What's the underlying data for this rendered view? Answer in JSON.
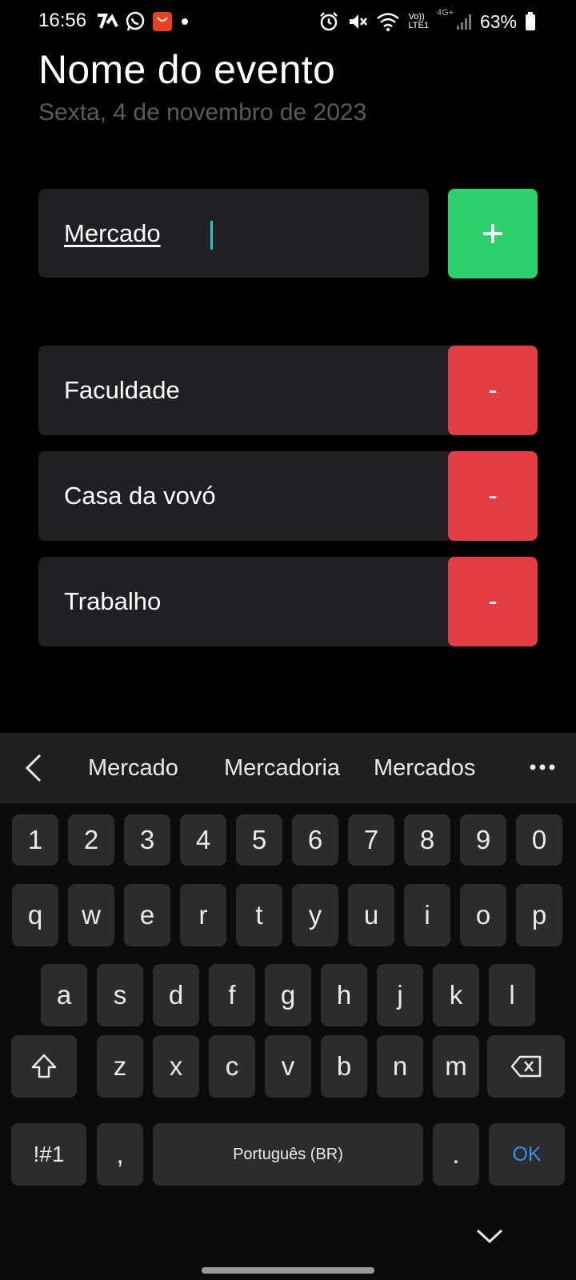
{
  "status_bar": {
    "time": "16:56",
    "network": "4G+",
    "battery": "63%",
    "left_icons": [
      "activity-app-icon",
      "whatsapp-icon",
      "aliexpress-icon",
      "dot-icon"
    ],
    "right_icons": [
      "alarm-icon",
      "mute-icon",
      "wifi-icon",
      "volte-icon",
      "signal-icon",
      "battery-icon"
    ],
    "volte_line1": "Vo))",
    "volte_line2": "LTE1"
  },
  "header": {
    "title": "Nome do evento",
    "date": "Sexta, 4 de novembro de 2023"
  },
  "input": {
    "value": "Mercado",
    "add_label": "+",
    "add_color": "#2ed06b"
  },
  "items": [
    {
      "label": "Faculdade",
      "remove_label": "-"
    },
    {
      "label": "Casa da vovó",
      "remove_label": "-"
    },
    {
      "label": "Trabalho",
      "remove_label": "-"
    }
  ],
  "remove_color": "#e33e46",
  "keyboard": {
    "suggestions": [
      "Mercado",
      "Mercadoria",
      "Mercados"
    ],
    "rows": [
      [
        "1",
        "2",
        "3",
        "4",
        "5",
        "6",
        "7",
        "8",
        "9",
        "0"
      ],
      [
        "q",
        "w",
        "e",
        "r",
        "t",
        "y",
        "u",
        "i",
        "o",
        "p"
      ],
      [
        "a",
        "s",
        "d",
        "f",
        "g",
        "h",
        "j",
        "k",
        "l"
      ],
      [
        "z",
        "x",
        "c",
        "v",
        "b",
        "n",
        "m"
      ]
    ],
    "symbols_label": "!#1",
    "comma_label": ",",
    "space_label": "Português (BR)",
    "period_label": ".",
    "ok_label": "OK",
    "ok_color": "#3d8df2"
  }
}
